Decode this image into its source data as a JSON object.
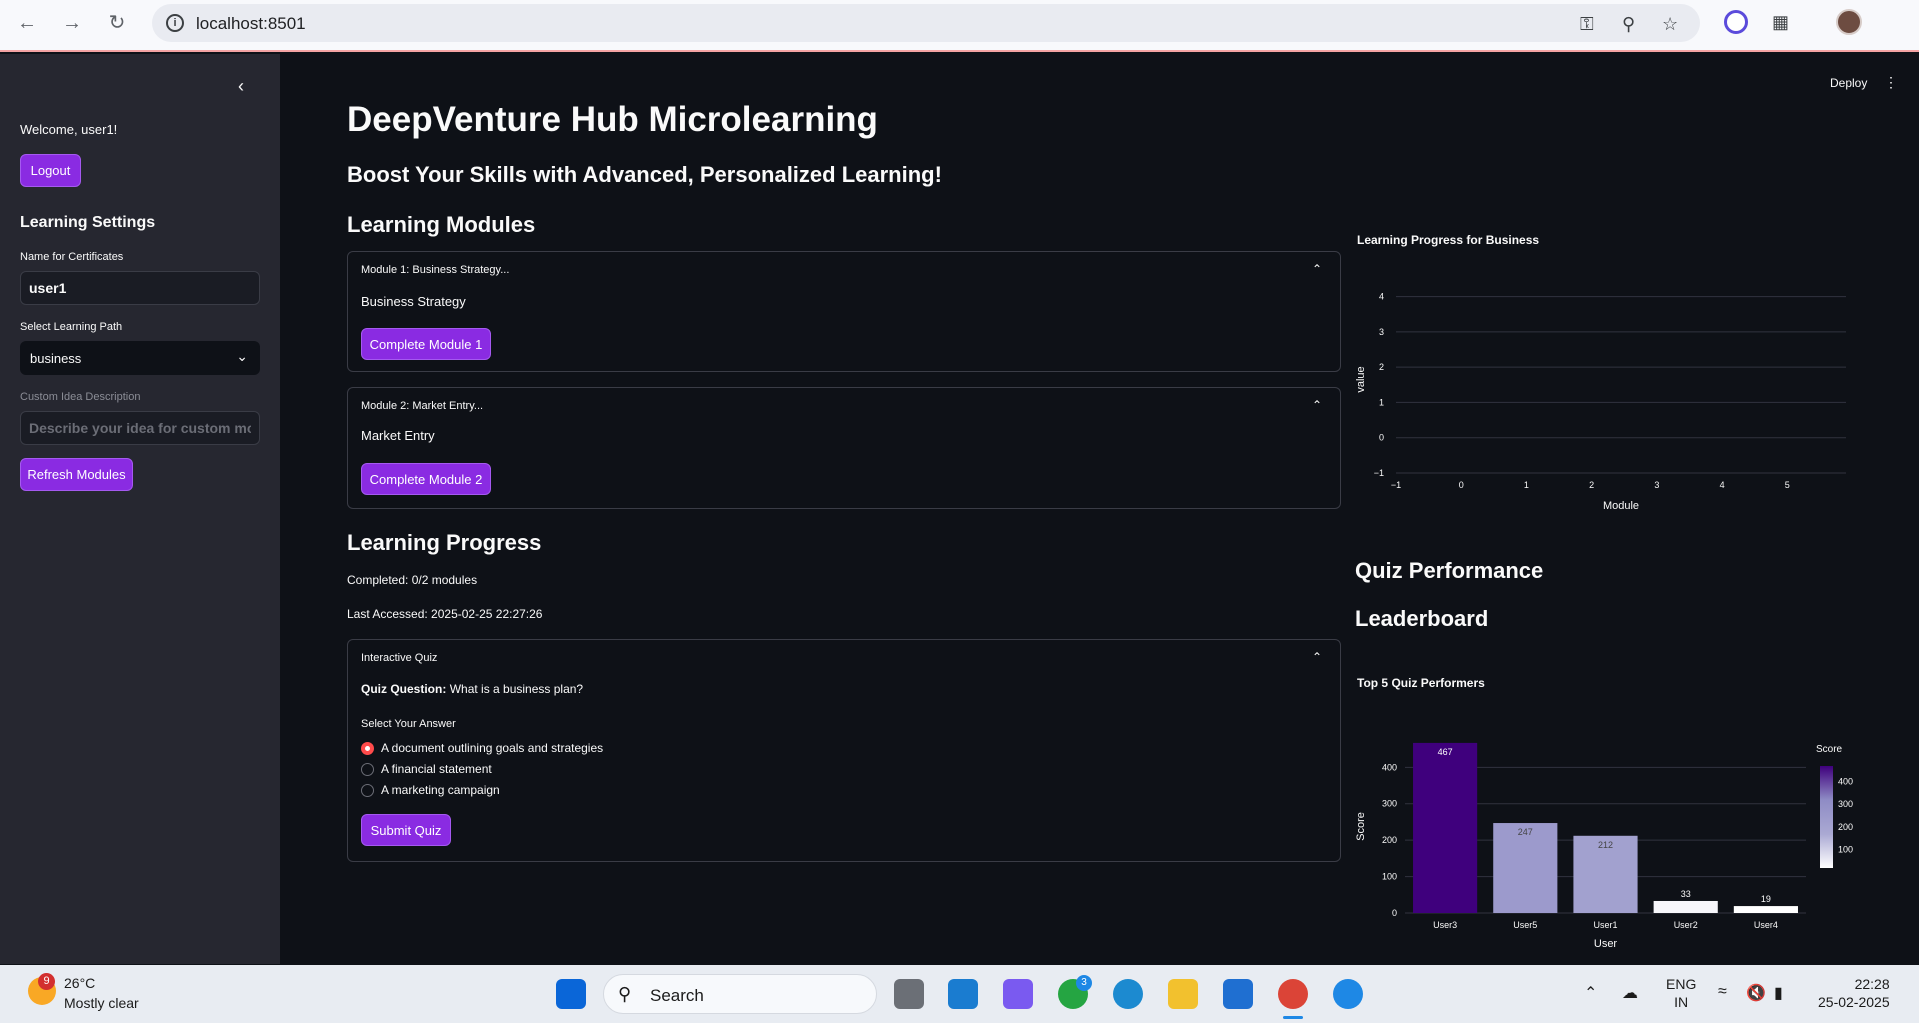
{
  "browser": {
    "url": "localhost:8501"
  },
  "sidebar": {
    "welcome": "Welcome, user1!",
    "logout_label": "Logout",
    "settings_heading": "Learning Settings",
    "cert_name_label": "Name for Certificates",
    "cert_name_value": "user1",
    "path_label": "Select Learning Path",
    "path_value": "business",
    "custom_label": "Custom Idea Description",
    "custom_placeholder": "Describe your idea for custom modules",
    "refresh_label": "Refresh Modules"
  },
  "header": {
    "deploy_label": "Deploy"
  },
  "main": {
    "title": "DeepVenture Hub Microlearning",
    "subtitle": "Boost Your Skills with Advanced, Personalized Learning!",
    "modules_heading": "Learning Modules",
    "modules": [
      {
        "title": "Module 1: Business Strategy...",
        "text": "Business Strategy",
        "button": "Complete Module 1"
      },
      {
        "title": "Module 2: Market Entry...",
        "text": "Market Entry",
        "button": "Complete Module 2"
      }
    ],
    "progress_heading": "Learning Progress",
    "completed": "Completed: 0/2 modules",
    "last_accessed": "Last Accessed: 2025-02-25 22:27:26",
    "quiz": {
      "title": "Interactive Quiz",
      "question_label": "Quiz Question:",
      "question": "What is a business plan?",
      "select_label": "Select Your Answer",
      "options": [
        "A document outlining goals and strategies",
        "A financial statement",
        "A marketing campaign"
      ],
      "selected_index": 0,
      "submit_label": "Submit Quiz"
    }
  },
  "right": {
    "quiz_perf_heading": "Quiz Performance",
    "leaderboard_heading": "Leaderboard"
  },
  "chart_data": [
    {
      "type": "line",
      "title": "Learning Progress for Business",
      "xlabel": "Module",
      "ylabel": "value",
      "x_ticks": [
        "−1",
        "0",
        "1",
        "2",
        "3",
        "4",
        "5"
      ],
      "y_ticks": [
        "−1",
        "0",
        "1",
        "2",
        "3",
        "4"
      ],
      "xlim": [
        -1,
        5.9
      ],
      "ylim": [
        -1,
        4.3
      ],
      "series": [],
      "grid": true
    },
    {
      "type": "bar",
      "title": "Top 5 Quiz Performers",
      "xlabel": "User",
      "ylabel": "Score",
      "categories": [
        "User3",
        "User5",
        "User1",
        "User2",
        "User4"
      ],
      "values": [
        467,
        247,
        212,
        33,
        19
      ],
      "y_ticks": [
        "0",
        "100",
        "200",
        "300",
        "400"
      ],
      "ylim": [
        0,
        475
      ],
      "colorscale": [
        "#ffffff",
        "#aaa9d3",
        "#8f8cc5",
        "#3f007d"
      ],
      "colorbar_title": "Score",
      "colorbar_ticks": [
        "100",
        "200",
        "300",
        "400"
      ],
      "grid": true
    }
  ],
  "taskbar": {
    "weather_badge": "9",
    "temperature": "26°C",
    "weather": "Mostly clear",
    "search_label": "Search",
    "whatsapp_badge": "3",
    "lang_top": "ENG",
    "lang_bottom": "IN",
    "time": "22:28",
    "date": "25-02-2025"
  }
}
